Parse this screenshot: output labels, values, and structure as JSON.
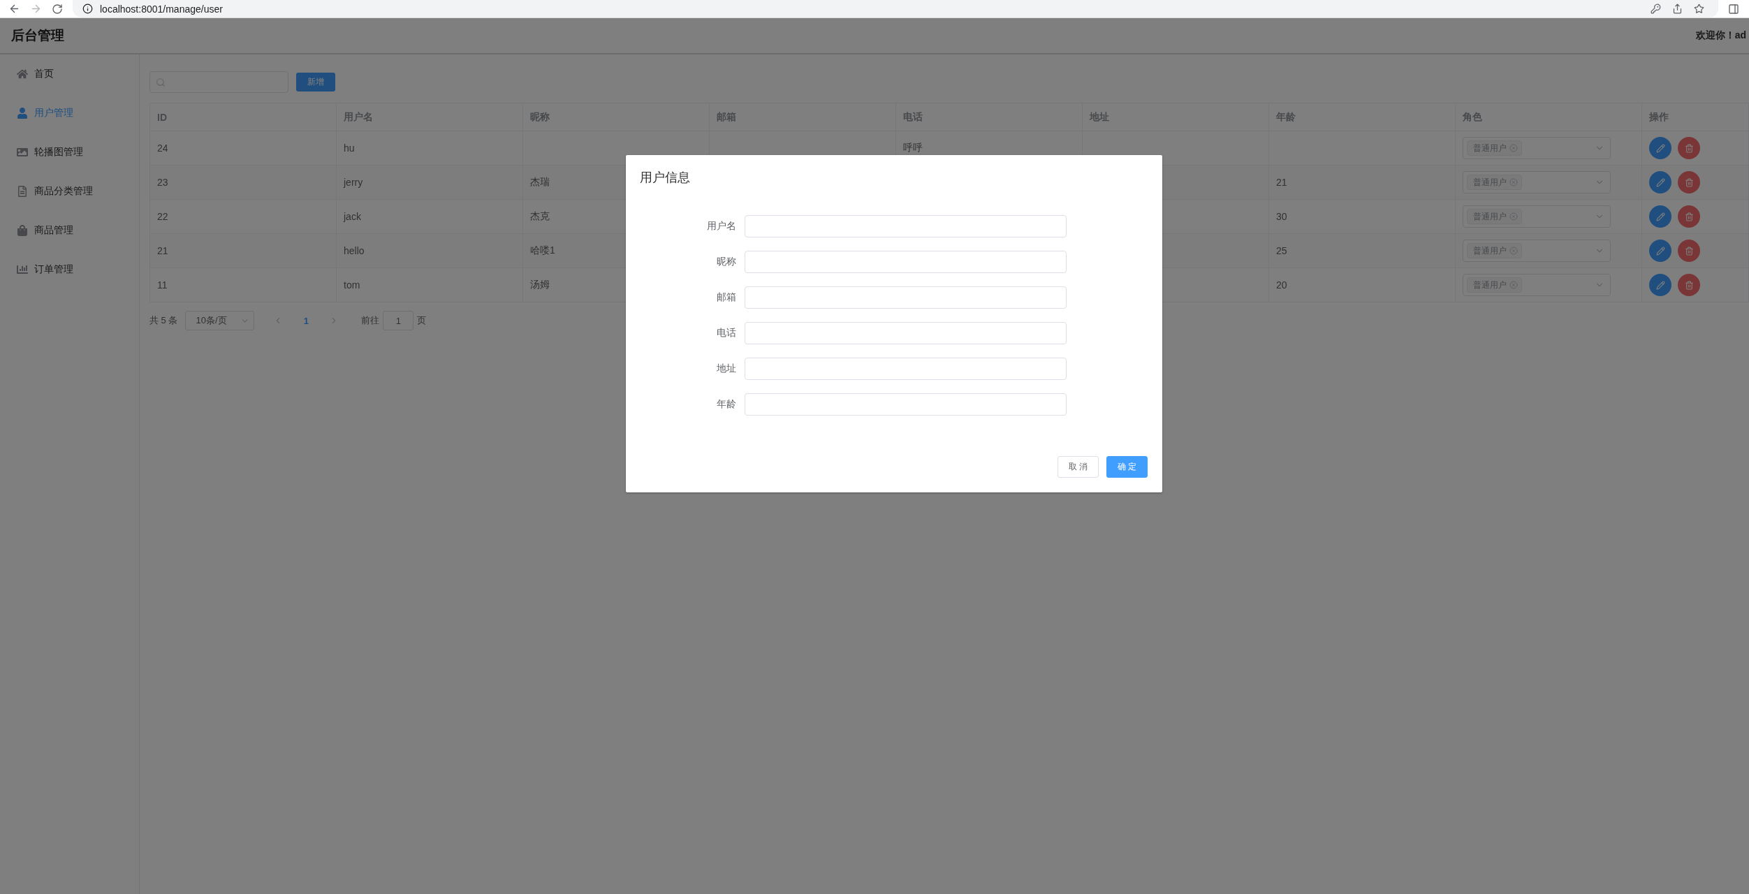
{
  "browser": {
    "url": "localhost:8001/manage/user"
  },
  "header": {
    "title": "后台管理",
    "welcome": "欢迎你！ad"
  },
  "sidebar": {
    "items": [
      {
        "label": "首页",
        "selected": false
      },
      {
        "label": "用户管理",
        "selected": true
      },
      {
        "label": "轮播图管理",
        "selected": false
      },
      {
        "label": "商品分类管理",
        "selected": false
      },
      {
        "label": "商品管理",
        "selected": false
      },
      {
        "label": "订单管理",
        "selected": false
      }
    ]
  },
  "toolbar": {
    "add_button": "新增"
  },
  "table": {
    "columns": [
      "ID",
      "用户名",
      "昵称",
      "邮箱",
      "电话",
      "地址",
      "年龄",
      "角色",
      "操作"
    ],
    "rows": [
      {
        "id": "24",
        "username": "hu",
        "phone": "呼呼",
        "role": "普通用户"
      },
      {
        "id": "23",
        "username": "jerry",
        "nickname": "杰瑞",
        "age": "21",
        "role": "普通用户"
      },
      {
        "id": "22",
        "username": "jack",
        "nickname": "杰克",
        "age": "30",
        "role": "普通用户"
      },
      {
        "id": "21",
        "username": "hello",
        "nickname": "哈喽1",
        "age": "25",
        "role": "普通用户"
      },
      {
        "id": "11",
        "username": "tom",
        "nickname": "汤姆",
        "age": "20",
        "role": "普通用户"
      }
    ]
  },
  "pagination": {
    "total": "共 5 条",
    "page_size": "10条/页",
    "pages": [
      {
        "label": "1",
        "selected": true
      }
    ],
    "jump_label": "前往",
    "jump_value": "1",
    "jump_suffix": "页"
  },
  "dialog": {
    "open": true,
    "title": "用户信息",
    "fields": [
      {
        "label": "用户名"
      },
      {
        "label": "昵称"
      },
      {
        "label": "邮箱"
      },
      {
        "label": "电话"
      },
      {
        "label": "地址"
      },
      {
        "label": "年龄"
      }
    ],
    "buttons": [
      {
        "label": "取 消",
        "kind": "default"
      },
      {
        "label": "确 定",
        "kind": "primary"
      }
    ]
  }
}
